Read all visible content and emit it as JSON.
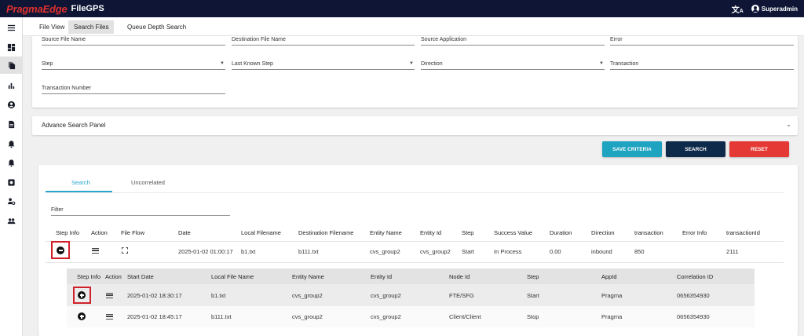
{
  "header": {
    "brand": "PragmaEdge",
    "product": "FileGPS",
    "translate_icon": "translate-icon",
    "user": "Superadmin"
  },
  "sidebar": {
    "icons": [
      "menu-icon",
      "dashboard-icon",
      "files-icon",
      "bar-chart-icon",
      "account-icon",
      "document-icon",
      "alert-icon",
      "alert-2-icon",
      "settings-icon",
      "user-settings-icon",
      "group-icon"
    ]
  },
  "tabs": {
    "file_view": "File View",
    "search_files": "Search Files",
    "queue_depth": "Queue Depth Search"
  },
  "search": {
    "source_file_name": "Source File Name",
    "destination_file_name": "Destination File Name",
    "source_application": "Source Application",
    "error": "Error",
    "step": "Step",
    "last_known_step": "Last Known Step",
    "direction": "Direction",
    "transaction": "Transaction",
    "transaction_number": "Transaction Number"
  },
  "advance": {
    "label": "Advance Search Panel"
  },
  "buttons": {
    "save": "SAVE CRITERIA",
    "search": "SEARCH",
    "reset": "RESET"
  },
  "colors": {
    "save": "#1ea3c0",
    "search": "#0e2a4b",
    "reset": "#e53935",
    "accent": "#2aa7cf",
    "highlight": "#d0202a"
  },
  "results": {
    "tabs": {
      "search": "Search",
      "uncorrelated": "Uncorrelated"
    },
    "filter_label": "Filter",
    "columns": [
      "Step Info",
      "Action",
      "File Flow",
      "Date",
      "Local Filename",
      "Destination Filename",
      "Entity Name",
      "Entity Id",
      "Step",
      "Success Value",
      "Duration",
      "Direction",
      "transaction",
      "Error Info",
      "transactionId"
    ],
    "row": {
      "date": "2025-01-02 01:00:17",
      "local_filename": "b1.txt",
      "destination_filename": "b111.txt",
      "entity_name": "cvs_group2",
      "entity_id": "cvs_group2",
      "step": "Start",
      "success_value": "In Process",
      "duration": "0.00",
      "direction": "inbound",
      "transaction": "850",
      "error_info": "",
      "transaction_id": "2111"
    }
  },
  "sub_table": {
    "columns": [
      "Step Info",
      "Action",
      "Start Date",
      "Local File Name",
      "Entity Name",
      "Entity Id",
      "Node Id",
      "Step",
      "AppId",
      "Correlation ID"
    ],
    "rows": [
      {
        "start_date": "2025-01-02 18:30:17",
        "local_file_name": "b1.txt",
        "entity_name": "cvs_group2",
        "entity_id": "cvs_group2",
        "node_id": "FTE/SFG",
        "step": "Start",
        "app_id": "Pragma",
        "correlation_id": "0656354930"
      },
      {
        "start_date": "2025-01-02 18:45:17",
        "local_file_name": "b111.txt",
        "entity_name": "cvs_group2",
        "entity_id": "cvs_group2",
        "node_id": "Client/Client",
        "step": "Stop",
        "app_id": "Pragma",
        "correlation_id": "0656354930"
      }
    ]
  }
}
